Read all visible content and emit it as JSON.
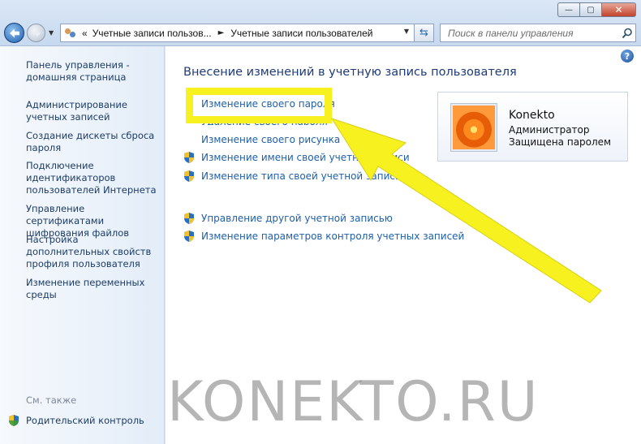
{
  "window": {
    "min_label": "—",
    "max_label": "▢",
    "close_label": "✕"
  },
  "address": {
    "chevron": "«",
    "crumb1": "Учетные записи пользов...",
    "separator": "►",
    "crumb2": "Учетные записи пользователей"
  },
  "search": {
    "placeholder": "Поиск в панели управления"
  },
  "sidebar": {
    "items": [
      {
        "label": "Панель управления - домашняя страница"
      },
      {
        "label": "Администрирование учетных записей"
      },
      {
        "label": "Создание дискеты сброса пароля"
      },
      {
        "label": "Подключение идентификаторов пользователей Интернета"
      },
      {
        "label": "Управление сертификатами шифрования файлов"
      },
      {
        "label": "Настройка дополнительных свойств профиля пользователя"
      },
      {
        "label": "Изменение переменных среды"
      }
    ],
    "see_also": "См. также",
    "parental": "Родительский контроль"
  },
  "main": {
    "title": "Внесение изменений в учетную запись пользователя",
    "tasks": [
      {
        "label": "Изменение своего пароля"
      },
      {
        "label": "Удаление своего пароля"
      },
      {
        "label": "Изменение своего рисунка"
      },
      {
        "label": "Изменение имени своей учетной записи"
      },
      {
        "label": "Изменение типа своей учетной записи"
      },
      {
        "label": "Управление другой учетной записью"
      },
      {
        "label": "Изменение параметров контроля учетных записей"
      }
    ]
  },
  "user": {
    "name": "Konekto",
    "role": "Администратор",
    "status": "Защищена паролем"
  },
  "watermark": "KONEKTO.RU",
  "colors": {
    "highlight": "#f7f120",
    "link": "#1e5fa8",
    "title": "#1e3b78"
  }
}
